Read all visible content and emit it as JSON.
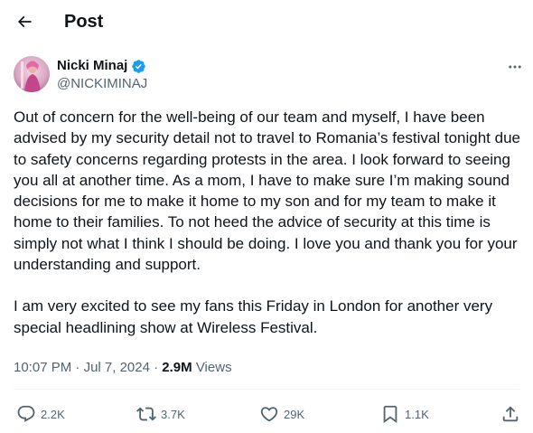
{
  "header": {
    "title": "Post",
    "back_icon": "arrow-left-icon"
  },
  "author": {
    "name": "Nicki Minaj",
    "handle": "@NICKIMINAJ",
    "verified_icon": "verified-badge-icon",
    "verified_color": "#1d9bf0"
  },
  "post": {
    "paragraphs": [
      "Out of concern for the well-being of our team and myself, I have been advised by my security detail not to travel to Romania’s festival tonight due to safety concerns regarding protests in the area. I look forward to seeing you all at another time. As a mom, I have to make sure I’m making sound decisions for me to make it home to my son and for my team to make it home to their families. To not heed the advice of security at this time is simply not what I think I should be doing. I love you and thank you for your understanding and support.",
      "I am very excited to see my fans this Friday in London for another very special headlining show at Wireless Festival."
    ],
    "time": "10:07 PM",
    "date": "Jul 7, 2024",
    "separator": "·",
    "views_count": "2.9M",
    "views_label": "Views"
  },
  "actions": {
    "reply": "2.2K",
    "repost": "3.7K",
    "like": "29K",
    "bookmark": "1.1K"
  },
  "colors": {
    "text": "#0f1419",
    "secondary": "#536471",
    "accent": "#1d9bf0"
  }
}
